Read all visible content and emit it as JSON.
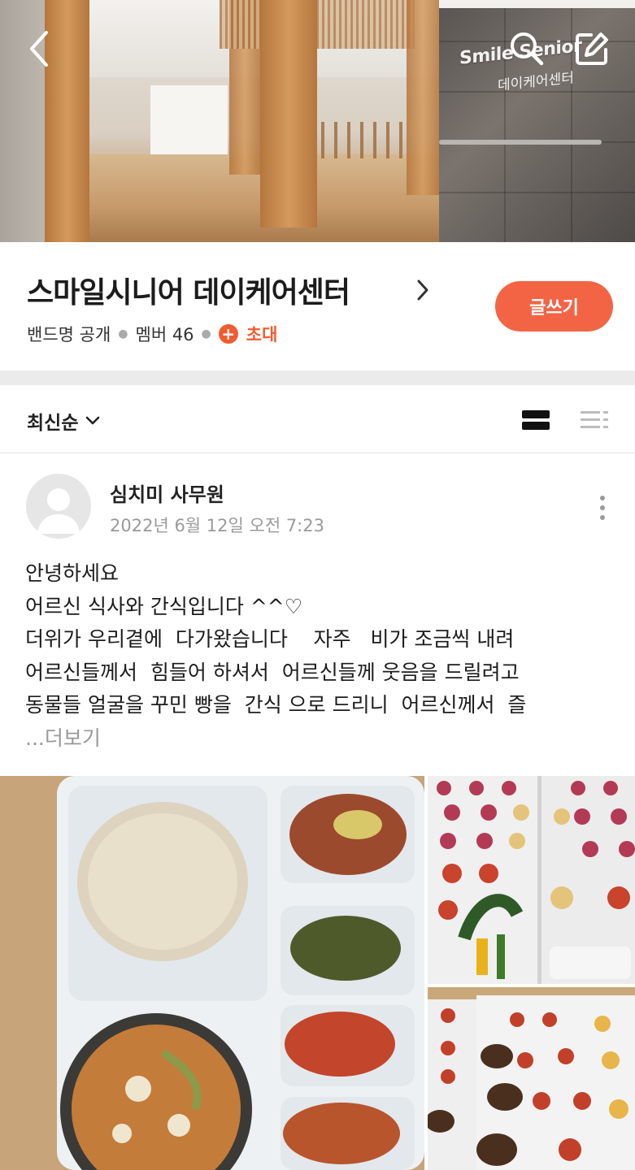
{
  "cover": {
    "sign_text": "Smile Senior",
    "sign_subtext": "데이케어센터"
  },
  "band": {
    "name": "스마일시니어 데이케어센터",
    "privacy": "밴드명 공개",
    "members_label": "멤버 46",
    "invite_label": "초대",
    "write_button": "글쓰기"
  },
  "sort": {
    "label": "최신순"
  },
  "post": {
    "author": "심치미 사무원",
    "date": "2022년 6월 12일 오전 7:23",
    "lines": [
      "안녕하세요",
      "어르신 식사와 간식입니다 ^^♡",
      "더위가 우리곁에  다가왔습니다    자주   비가 조금씩 내려",
      "어르신들께서  힘들어 하셔서  어르신들께 웃음을 드릴려고",
      "동물들 얼굴을 꾸민 빵을  간식 으로 드리니  어르신께서  즐"
    ],
    "see_more": "...더보기"
  },
  "icons": {
    "back": "chevron-left-icon",
    "search": "search-icon",
    "write": "edit-icon",
    "more": "more-vertical-icon"
  },
  "colors": {
    "accent": "#f36445",
    "invite": "#f25a2f"
  }
}
